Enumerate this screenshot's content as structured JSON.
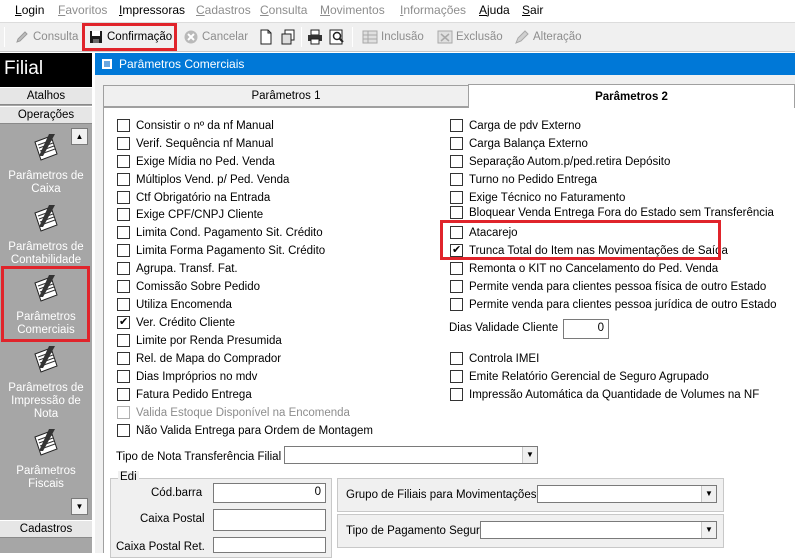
{
  "menu": [
    "Login",
    "Favoritos",
    "Impressoras",
    "Cadastros",
    "Consulta",
    "Movimentos",
    "Informações",
    "Ajuda",
    "Sair"
  ],
  "toolbar": {
    "consulta": "Consulta",
    "confirmacao": "Confirmação",
    "cancelar": "Cancelar",
    "inclusao": "Inclusão",
    "exclusao": "Exclusão",
    "alteracao": "Alteração"
  },
  "sidebar": {
    "title": "Filial",
    "atalhos": "Atalhos",
    "operacoes": "Operações",
    "cadastros": "Cadastros",
    "items": [
      {
        "label": "Parâmetros de Caixa"
      },
      {
        "label": "Parâmetros de Contabilidade"
      },
      {
        "label": "Parâmetros Comerciais"
      },
      {
        "label": "Parâmetros de Impressão de Nota"
      },
      {
        "label": "Parâmetros Fiscais"
      }
    ]
  },
  "window": {
    "title": "Parâmetros Comerciais"
  },
  "tabs": [
    "Parâmetros 1",
    "Parâmetros 2"
  ],
  "left_checks": [
    {
      "label": "Consistir o nº da nf Manual",
      "checked": false,
      "disabled": false
    },
    {
      "label": "Verif. Sequência nf Manual",
      "checked": false,
      "disabled": false
    },
    {
      "label": "Exige Mídia no Ped. Venda",
      "checked": false,
      "disabled": false
    },
    {
      "label": "Múltiplos Vend. p/ Ped. Venda",
      "checked": false,
      "disabled": false
    },
    {
      "label": "Ctf Obrigatório na Entrada",
      "checked": false,
      "disabled": false
    },
    {
      "label": "Exige CPF/CNPJ Cliente",
      "checked": false,
      "disabled": false
    },
    {
      "label": "Limita Cond. Pagamento Sit. Crédito",
      "checked": false,
      "disabled": false
    },
    {
      "label": "Limita Forma Pagamento Sit. Crédito",
      "checked": false,
      "disabled": false
    },
    {
      "label": "Agrupa. Transf. Fat.",
      "checked": false,
      "disabled": false
    },
    {
      "label": "Comissão Sobre Pedido",
      "checked": false,
      "disabled": false
    },
    {
      "label": "Utiliza Encomenda",
      "checked": false,
      "disabled": false
    },
    {
      "label": "Ver. Crédito Cliente",
      "checked": true,
      "disabled": false
    },
    {
      "label": "Limite por Renda Presumida",
      "checked": false,
      "disabled": false
    },
    {
      "label": "Rel. de Mapa do Comprador",
      "checked": false,
      "disabled": false
    },
    {
      "label": "Dias Impróprios no mdv",
      "checked": false,
      "disabled": false
    },
    {
      "label": "Fatura Pedido Entrega",
      "checked": false,
      "disabled": false
    },
    {
      "label": "Valida Estoque Disponível na Encomenda",
      "checked": false,
      "disabled": true
    },
    {
      "label": "Não Valida Entrega para Ordem de Montagem",
      "checked": false,
      "disabled": false
    }
  ],
  "right_checks_top": [
    {
      "label": "Carga de pdv Externo",
      "checked": false
    },
    {
      "label": "Carga Balança Externo",
      "checked": false
    },
    {
      "label": "Separação Autom.p/ped.retira Depósito",
      "checked": false
    },
    {
      "label": "Turno no Pedido Entrega",
      "checked": false
    },
    {
      "label": "Exige Técnico no Faturamento",
      "checked": false
    },
    {
      "label": "Bloquear Venda Entrega Fora do Estado sem Transferência",
      "checked": false
    },
    {
      "label": "Atacarejo",
      "checked": false
    },
    {
      "label": "Trunca Total do Item nas Movimentações de Saída",
      "checked": true
    },
    {
      "label": "Remonta o KIT no Cancelamento do Ped. Venda",
      "checked": false
    },
    {
      "label": "Permite venda para clientes pessoa física de outro Estado",
      "checked": false
    },
    {
      "label": "Permite venda para clientes pessoa jurídica de outro Estado",
      "checked": false
    }
  ],
  "dias_validade": {
    "label": "Dias Validade Cliente",
    "value": "0"
  },
  "right_checks_bottom": [
    {
      "label": "Controla IMEI",
      "checked": false
    },
    {
      "label": "Emite Relatório Gerencial de Seguro Agrupado",
      "checked": false
    },
    {
      "label": "Impressão Automática da Quantidade de Volumes na NF",
      "checked": false
    }
  ],
  "tipo_nota": {
    "label": "Tipo de Nota Transferência Filial",
    "value": ""
  },
  "edi": {
    "title": "Edi",
    "codbarra_label": "Cód.barra",
    "codbarra_value": "0",
    "caixa_postal_label": "Caixa Postal",
    "caixa_postal_value": "",
    "caixa_postal_ret_label": "Caixa Postal Ret.",
    "caixa_postal_ret_value": ""
  },
  "grupo_filiais": {
    "label": "Grupo de Filiais para Movimentações",
    "value": ""
  },
  "tipo_pagamento": {
    "label": "Tipo de Pagamento Seguro",
    "value": ""
  },
  "colors": {
    "accent": "#0078d7",
    "highlight": "#e0242b",
    "sidebar": "#a6a6a6"
  }
}
